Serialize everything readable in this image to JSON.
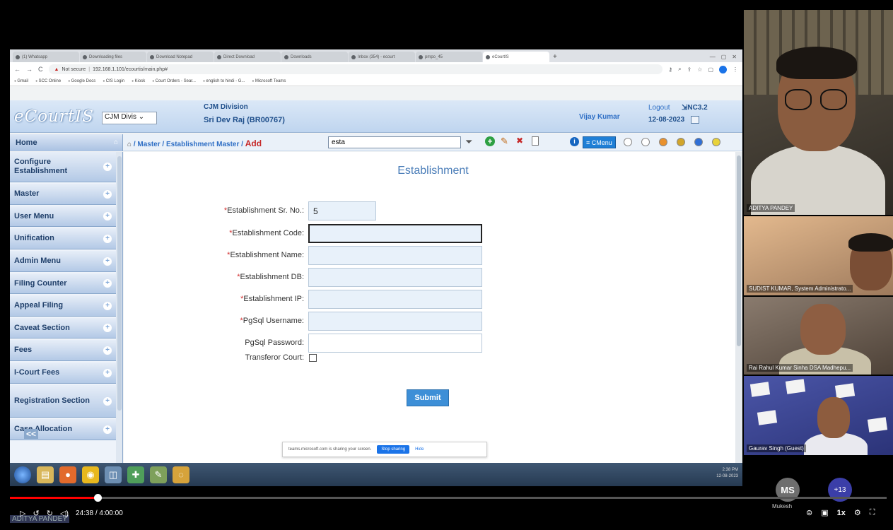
{
  "browser": {
    "tabs": [
      {
        "label": "(1) Whatsapp"
      },
      {
        "label": "Downloading files"
      },
      {
        "label": "Download Notepad"
      },
      {
        "label": "Direct Download"
      },
      {
        "label": "Downloads"
      },
      {
        "label": "Inbox (354) - ecourt"
      },
      {
        "label": "pmpo_45"
      },
      {
        "label": "eCourtIS",
        "active": true
      }
    ],
    "url_warning": "Not secure",
    "url": "192.168.1.101/ecourtis/main.php#",
    "bookmarks": [
      "Gmail",
      "SCC Online",
      "Google Docs",
      "CIS Login",
      "Kiosk",
      "Court Orders - Sear...",
      "english to hindi - G...",
      "Microsoft Teams"
    ]
  },
  "header": {
    "logo_main": "eCourt",
    "logo_suffix": "IS",
    "division_select": "CJM Divis",
    "division_title": "CJM Division",
    "officer": "Sri Dev Raj (BR00767)",
    "user_name": "Vijay Kumar",
    "logout": "Logout",
    "version": "NC3.2",
    "date": "12-08-2023"
  },
  "toolbar": {
    "home_label": "Home",
    "breadcrumb": {
      "sep": " / ",
      "master": "Master",
      "section": "Establishment Master",
      "action": "Add"
    },
    "search_value": "esta",
    "cmenu_label": "≡ CMenu",
    "theme_colors": [
      "#ffffff",
      "#ffffff",
      "#e9912d",
      "#d1a52b",
      "#2f6fd6",
      "#e8d23a"
    ]
  },
  "sidebar": {
    "items": [
      {
        "label": "Configure Establishment"
      },
      {
        "label": "Master"
      },
      {
        "label": "User Menu"
      },
      {
        "label": "Unification"
      },
      {
        "label": "Admin Menu"
      },
      {
        "label": "Filing Counter"
      },
      {
        "label": "Appeal Filing"
      },
      {
        "label": "Caveat Section"
      },
      {
        "label": "Fees"
      },
      {
        "label": "I-Court Fees"
      },
      {
        "label": "Registration Section"
      },
      {
        "label": "Case Allocation"
      }
    ],
    "collapse": "<<"
  },
  "form": {
    "title": "Establishment",
    "fields": [
      {
        "label": "Establishment Sr. No.:",
        "required": true,
        "value": "5"
      },
      {
        "label": "Establishment Code:",
        "required": true,
        "value": ""
      },
      {
        "label": "Establishment Name:",
        "required": true,
        "value": ""
      },
      {
        "label": "Establishment DB:",
        "required": true,
        "value": ""
      },
      {
        "label": "Establishment IP:",
        "required": true,
        "value": ""
      },
      {
        "label": "PgSql Username:",
        "required": true,
        "value": ""
      },
      {
        "label": "PgSql Password:",
        "required": false,
        "value": ""
      }
    ],
    "transferor_label": "Transferor Court:",
    "submit": "Submit"
  },
  "share_bar": {
    "message": "teams.microsoft.com is sharing your screen.",
    "stop": "Stop sharing",
    "hide": "Hide"
  },
  "taskbar": {
    "clock_time": "2:38 PM",
    "clock_date": "12-08-2023"
  },
  "participants": [
    {
      "name": "ADITYA PANDEY"
    },
    {
      "name": "SUDIST KUMAR, System Administrato..."
    },
    {
      "name": "Rai Rahul Kumar Sinha DSA Madhepu..."
    },
    {
      "name": "Gaurav Singh (Guest)"
    }
  ],
  "meeting": {
    "avatar_initials": "MS",
    "avatar_name": "Mukesh",
    "more_count": "+13"
  },
  "player": {
    "timecode": "24:38 / 4:00:00",
    "progress": 0.1,
    "speaker_overlay": "ADITYA PANDEY",
    "speed": "1x"
  }
}
